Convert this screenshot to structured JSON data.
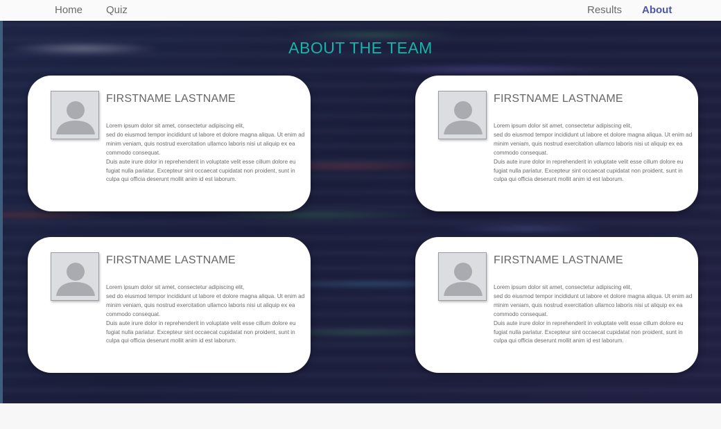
{
  "nav": {
    "left": [
      {
        "label": "Home",
        "active": false
      },
      {
        "label": "Quiz",
        "active": false
      }
    ],
    "right": [
      {
        "label": "Results",
        "active": false
      },
      {
        "label": "About",
        "active": true
      }
    ]
  },
  "page": {
    "title": "ABOUT THE TEAM"
  },
  "team": [
    {
      "name": "FIRSTNAME LASTNAME",
      "bio": "Lorem ipsum dolor sit amet, consectetur adipiscing elit,\nsed do eiusmod tempor incididunt ut labore et dolore magna aliqua. Ut enim ad minim veniam, quis nostrud exercitation ullamco laboris nisi ut aliquip ex ea commodo consequat.\nDuis aute irure dolor in reprehenderit in voluptate velit esse cillum dolore eu fugiat nulla pariatur. Excepteur sint occaecat cupidatat non proident, sunt in culpa qui officia deserunt mollit anim id est laborum."
    },
    {
      "name": "FIRSTNAME LASTNAME",
      "bio": "Lorem ipsum dolor sit amet, consectetur adipiscing elit,\nsed do eiusmod tempor incididunt ut labore et dolore magna aliqua. Ut enim ad minim veniam, quis nostrud exercitation ullamco laboris nisi ut aliquip ex ea commodo consequat.\nDuis aute irure dolor in reprehenderit in voluptate velit esse cillum dolore eu fugiat nulla pariatur. Excepteur sint occaecat cupidatat non proident, sunt in culpa qui officia deserunt mollit anim id est laborum."
    },
    {
      "name": "FIRSTNAME LASTNAME",
      "bio": "Lorem ipsum dolor sit amet, consectetur adipiscing elit,\nsed do eiusmod tempor incididunt ut labore et dolore magna aliqua. Ut enim ad minim veniam, quis nostrud exercitation ullamco laboris nisi ut aliquip ex ea commodo consequat.\nDuis aute irure dolor in reprehenderit in voluptate velit esse cillum dolore eu fugiat nulla pariatur. Excepteur sint occaecat cupidatat non proident, sunt in culpa qui officia deserunt mollit anim id est laborum."
    },
    {
      "name": "FIRSTNAME LASTNAME",
      "bio": "Lorem ipsum dolor sit amet, consectetur adipiscing elit,\nsed do eiusmod tempor incididunt ut labore et dolore magna aliqua. Ut enim ad minim veniam, quis nostrud exercitation ullamco laboris nisi ut aliquip ex ea commodo consequat.\nDuis aute irure dolor in reprehenderit in voluptate velit esse cillum dolore eu fugiat nulla pariatur. Excepteur sint occaecat cupidatat non proident, sunt in culpa qui officia deserunt mollit anim id est laborum."
    }
  ],
  "icons": {
    "avatar": "user-placeholder-icon"
  },
  "colors": {
    "accent_title": "#18b3a9",
    "nav_active": "#4a56a8",
    "nav_text": "#6b6b6b",
    "background": "#1c1f3f",
    "card": "#ffffff"
  }
}
